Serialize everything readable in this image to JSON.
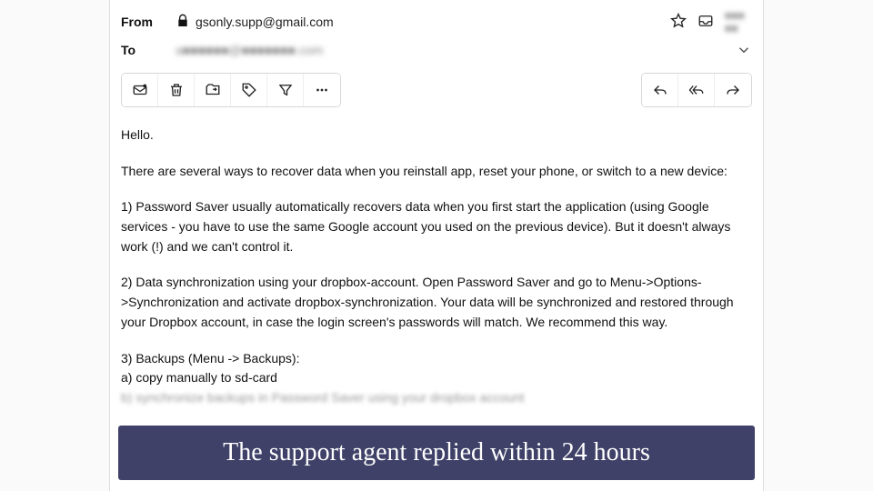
{
  "header": {
    "from_label": "From",
    "to_label": "To",
    "from_address": "gsonly.supp@gmail.com",
    "to_address_obscured": "a■■■■■■@■■■■■■■.com",
    "date_obscured": "■■■ ■■"
  },
  "toolbar": {
    "left": [
      "mark-unread",
      "trash",
      "move",
      "label",
      "filter",
      "more"
    ],
    "right": [
      "reply",
      "reply-all",
      "forward"
    ]
  },
  "body": {
    "greeting": "Hello.",
    "intro": "There are several ways to recover data when you reinstall app, reset your phone, or switch to a new device:",
    "p1": "1) Password Saver usually automatically recovers data when you first start the application (using Google services - you have to use the same Google account you used on the previous device). But it doesn't always work (!) and we can't control it.",
    "p2": "2) Data synchronization using your dropbox-account. Open Password Saver and go to Menu->Options->Synchronization and activate dropbox-synchronization. Your data will be synchronized and restored through your Dropbox account, in case the login screen's passwords will match. We recommend this way.",
    "p3_head": "3) Backups (Menu -> Backups):",
    "p3_a": "a) copy manually to sd-card",
    "p3_b_cut": "b) synchronize backups in Password Saver using your dropbox account"
  },
  "caption": "The support agent replied within 24 hours"
}
